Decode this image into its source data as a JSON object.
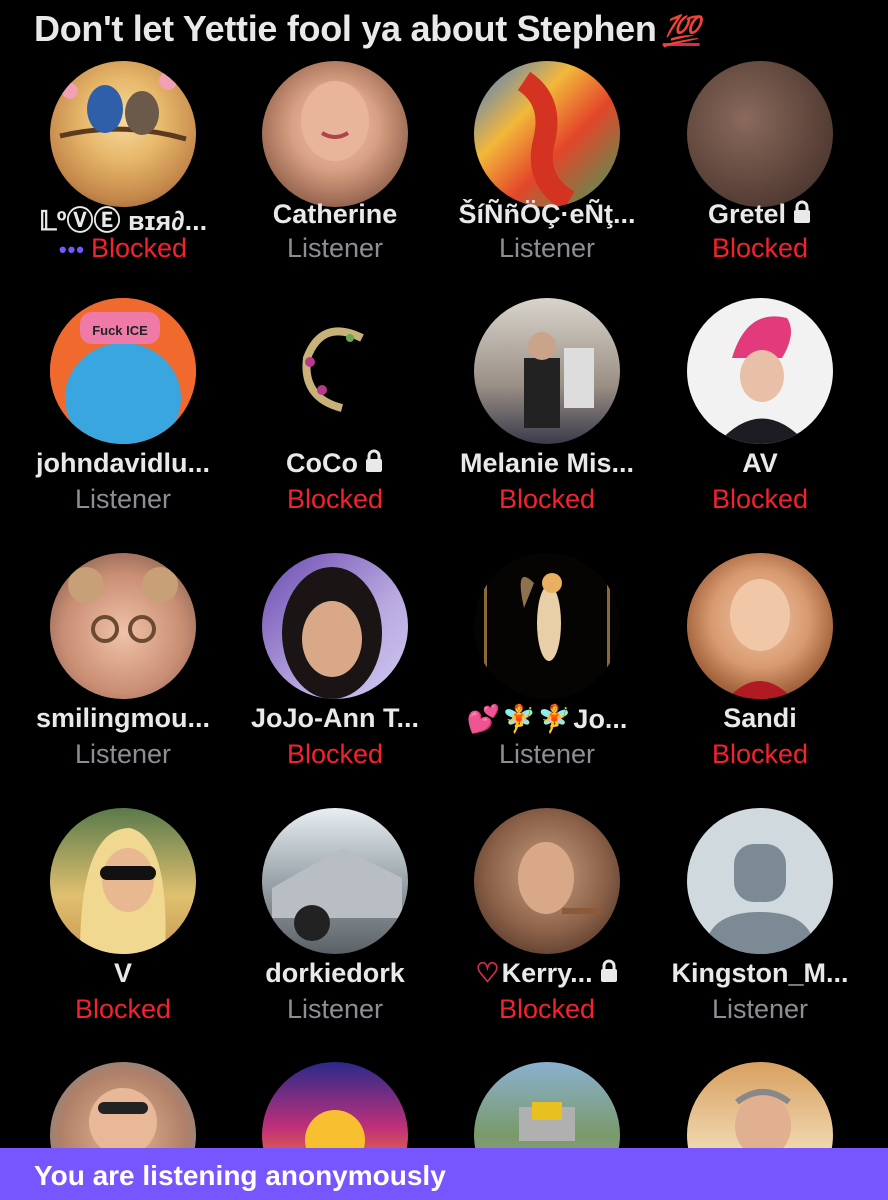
{
  "title": "Don't let Yettie fool ya about Stephen",
  "title_emoji": "💯",
  "footer": {
    "text": "You are listening anonymously"
  },
  "colors": {
    "background": "#000000",
    "blocked": "#f4212e",
    "listener": "#8b8f94",
    "accent": "#7856ff"
  },
  "participants": [
    {
      "name": "𝕃ºⓋⒺ ʙɪя∂...",
      "status": "Blocked",
      "speaking_icon": "audio-dots-icon"
    },
    {
      "name": "Catherine",
      "status": "Listener"
    },
    {
      "name": "ŠíÑñÖÇ·eÑţ...",
      "status": "Listener"
    },
    {
      "name": "Gretel",
      "status": "Blocked",
      "locked": true
    },
    {
      "name": "johndavidlu...",
      "status": "Listener"
    },
    {
      "name": "CoCo",
      "status": "Blocked",
      "locked": true
    },
    {
      "name": "Melanie Mis...",
      "status": "Blocked"
    },
    {
      "name": "AV",
      "status": "Blocked"
    },
    {
      "name": "smilingmou...",
      "status": "Listener"
    },
    {
      "name": "JoJo-Ann T...",
      "status": "Blocked"
    },
    {
      "name": "Jo...",
      "status": "Listener",
      "prefix_icons": [
        "heart-icon",
        "fairy-icon",
        "fairy-icon"
      ]
    },
    {
      "name": "Sandi",
      "status": "Blocked"
    },
    {
      "name": "V",
      "status": "Blocked"
    },
    {
      "name": "dorkiedork",
      "status": "Listener"
    },
    {
      "name": "Kerry...",
      "status": "Blocked",
      "locked": true,
      "prefix_icons": [
        "heart-outline-icon"
      ]
    },
    {
      "name": "Kingston_M...",
      "status": "Listener"
    }
  ]
}
